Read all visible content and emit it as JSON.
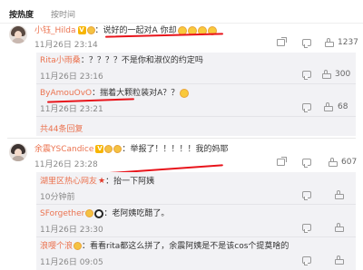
{
  "sort": {
    "hot": "按热度",
    "time": "按时间"
  },
  "comments": [
    {
      "user": "小钰_Hilda",
      "sep": "：",
      "text": "说好的一起对A 你却",
      "time": "11月26日 23:14",
      "likes": "1237"
    },
    {
      "user": "余震YSCandice",
      "sep": "：",
      "text": "举报了！！！！！我的妈耶",
      "time": "11月26日 23:28",
      "likes": "607"
    }
  ],
  "replies1": [
    {
      "user": "Rita小雨桑",
      "text": "：？？？？不是你和淑仪的约定吗",
      "time": "11月26日 23:16",
      "likes": "300"
    },
    {
      "user": "ByAmouOvO",
      "text": "：揣着大颗粒装对A？？",
      "time": "11月26日 23:21",
      "likes": "68"
    }
  ],
  "more_replies": "共44条回复",
  "replies2": [
    {
      "user": "湖里区热心网友",
      "text": "：抬一下阿姨",
      "time": "10分钟前"
    },
    {
      "user": "SForgether",
      "text": "：老阿姨吃醋了。",
      "time": "11月26日 23:30"
    },
    {
      "user": "浪嘤个浪",
      "text": "：看看rita都这么拼了，余震阿姨是不是该cos个提莫啥的",
      "time": "11月26日 09:05"
    }
  ],
  "colors": {
    "accent": "#eb7350",
    "mark": "#e8141b"
  }
}
